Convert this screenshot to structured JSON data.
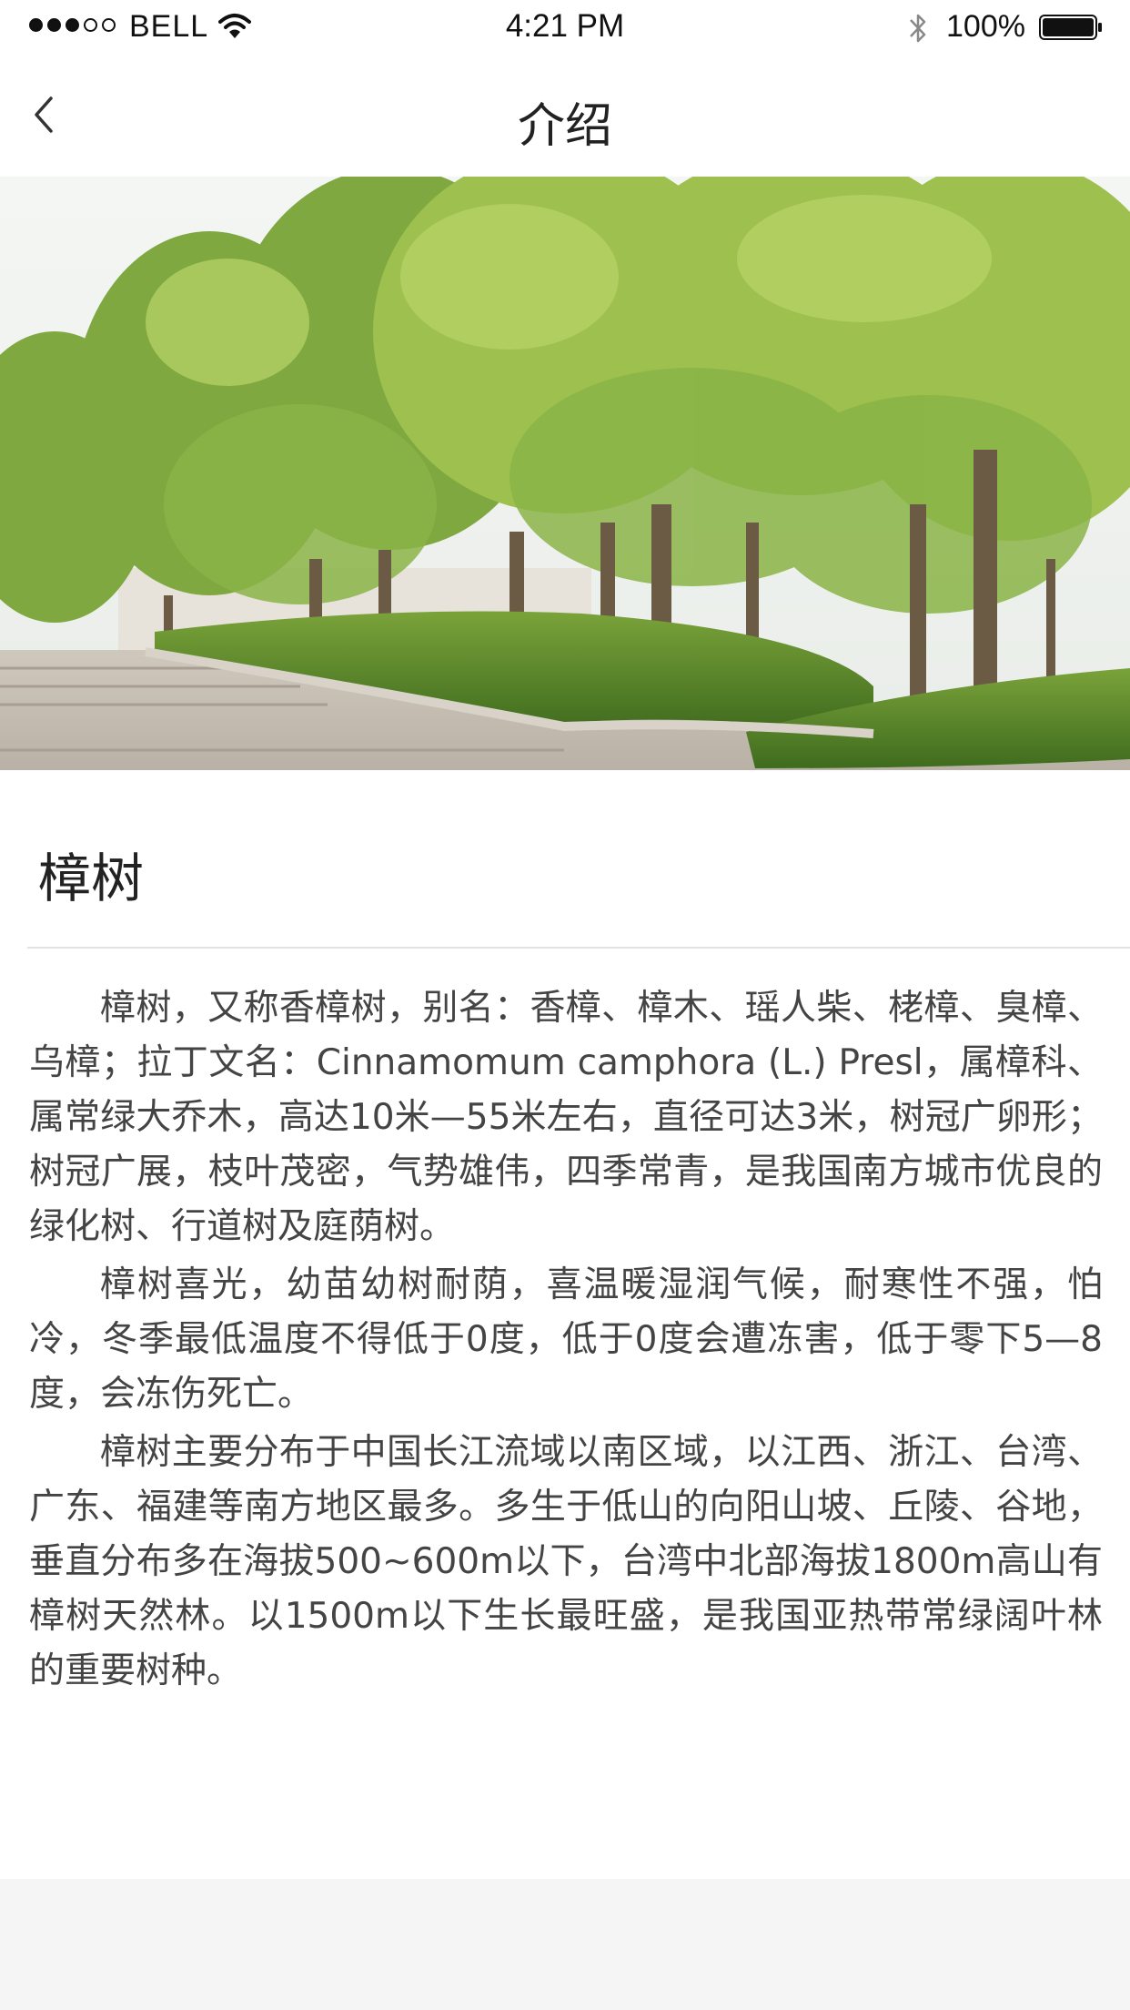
{
  "status_bar": {
    "carrier": "BELL",
    "time": "4:21 PM",
    "battery_percent": "100%",
    "signal_bars_full": 3,
    "signal_bars_total": 5,
    "battery_level": 1.0
  },
  "nav": {
    "title": "介绍",
    "back_icon": "chevron-left-icon"
  },
  "hero_image": {
    "subject": "camphor-trees-park"
  },
  "article": {
    "title": "樟树",
    "paragraphs": [
      "樟树，又称香樟树，别名：香樟、樟木、瑶人柴、栳樟、臭樟、乌樟；拉丁文名：Cinnamomum camphora (L.) Presl，属樟科、属常绿大乔木，高达10米—55米左右，直径可达3米，树冠广卵形；树冠广展，枝叶茂密，气势雄伟，四季常青，是我国南方城市优良的绿化树、行道树及庭荫树。",
      "樟树喜光，幼苗幼树耐荫，喜温暖湿润气候，耐寒性不强，怕冷，冬季最低温度不得低于0度，低于0度会遭冻害，低于零下5—8度，会冻伤死亡。",
      "樟树主要分布于中国长江流域以南区域，以江西、浙江、台湾、广东、福建等南方地区最多。多生于低山的向阳山坡、丘陵、谷地，垂直分布多在海拔500~600m以下，台湾中北部海拔1800m高山有樟树天然林。以1500m以下生长最旺盛，是我国亚热带常绿阔叶林的重要树种。"
    ]
  }
}
